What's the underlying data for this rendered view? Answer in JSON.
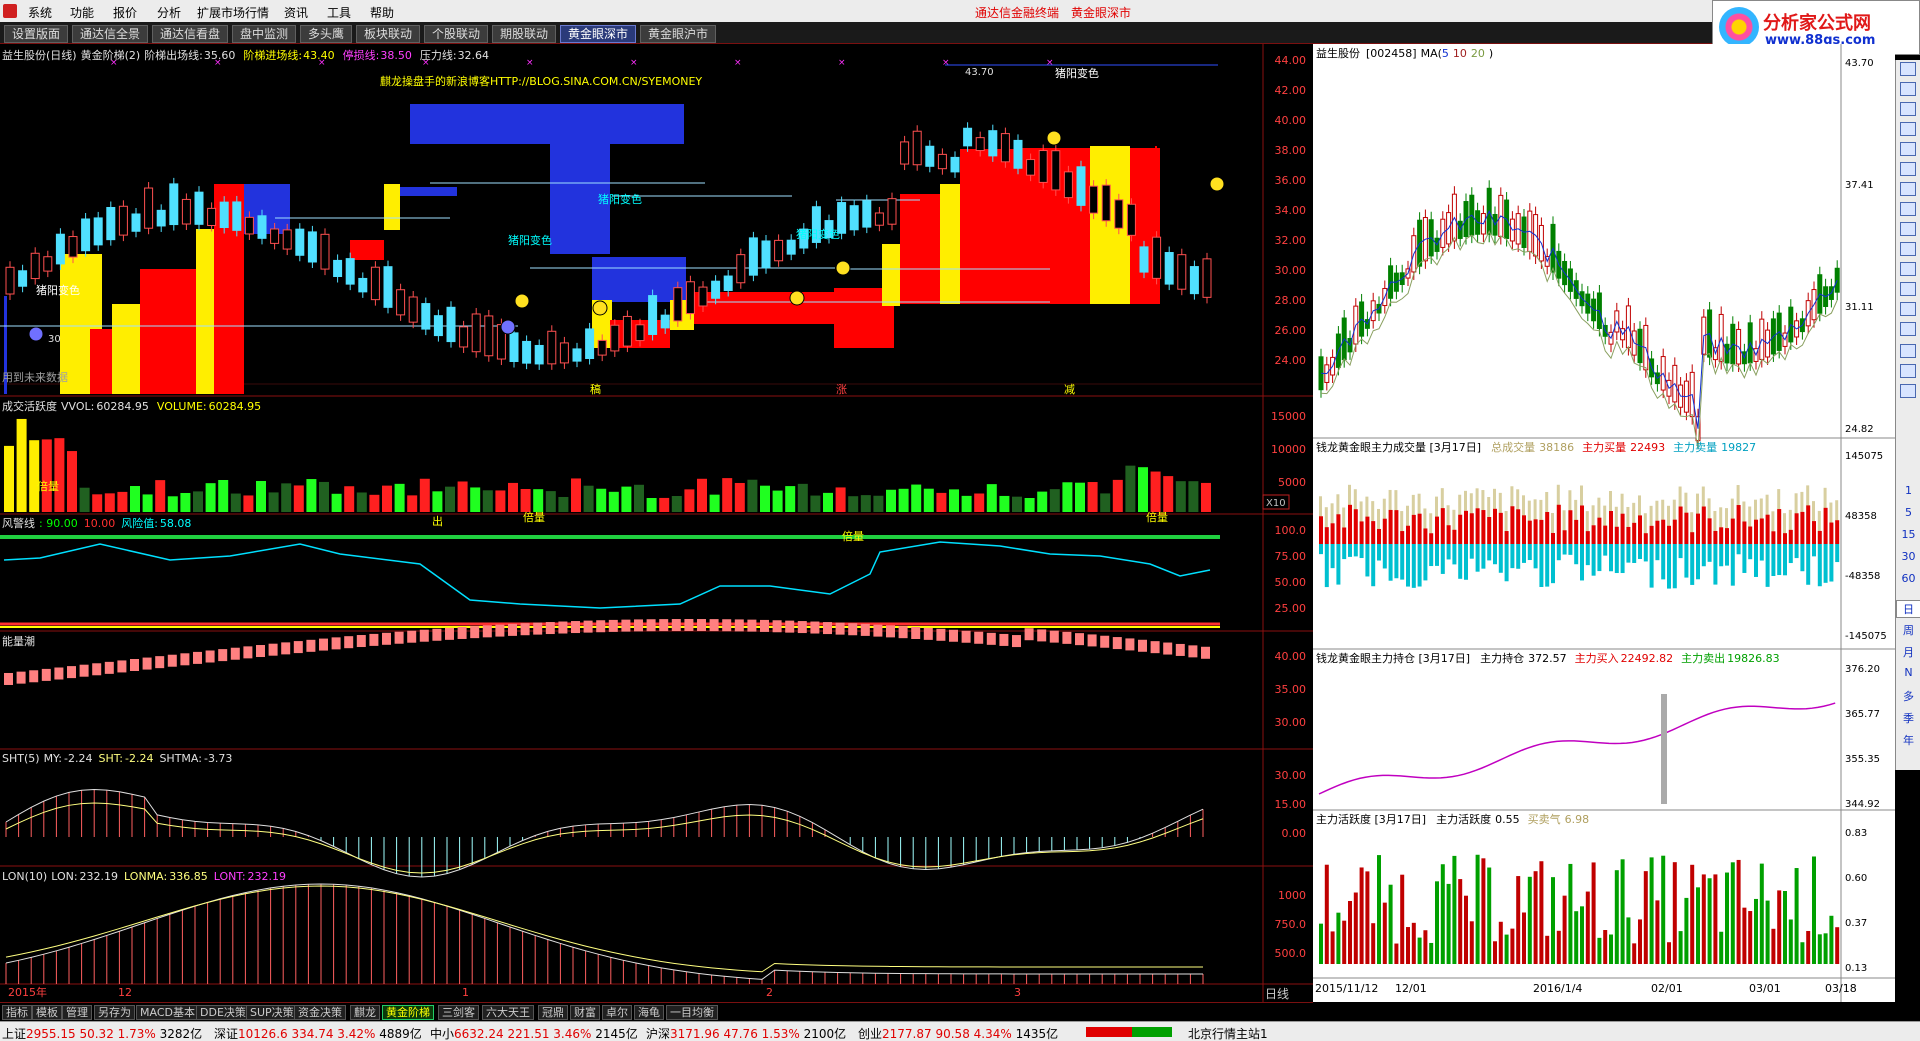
{
  "menu": {
    "items": [
      "系统",
      "功能",
      "报价",
      "分析",
      "扩展市场行情",
      "资讯",
      "工具",
      "帮助"
    ],
    "banner": [
      "通达信金融终端",
      "黄金眼深市"
    ]
  },
  "tabs": [
    "设置版面",
    "通达信全景",
    "通达信看盘",
    "盘中监测",
    "多头鹰",
    "板块联动",
    "个股联动",
    "期股联动",
    "黄金眼深市",
    "黄金眼沪市"
  ],
  "active_tab": "黄金眼深市",
  "site_logo": {
    "title": "分析家公式网",
    "url": "www.88gs.com"
  },
  "main": {
    "header": {
      "name": "益生股份(日线)",
      "indicator": "黄金阶梯(2)",
      "exit_label": "阶梯出场线:",
      "exit_value": "35.60",
      "entry_label": "阶梯进场线:",
      "entry_value": "43.40",
      "stoploss_label": "停损线:",
      "stoploss_value": "38.50",
      "pressure_label": "压力线:",
      "pressure_value": "32.64"
    },
    "blog": "麒龙操盘手的新浪博客HTTP://BLOG.SINA.COM.CN/SYEMONEY",
    "future_note": "用到未来数据",
    "marks": [
      "猪阳变色",
      "猪阳变色",
      "猪阳变色",
      "猪阳变色",
      "猪阳变色"
    ],
    "high_label": "43.70",
    "low_label": "30",
    "zone_labels": [
      "稿",
      "涨",
      "减"
    ],
    "price_axis": [
      "44.00",
      "42.00",
      "40.00",
      "38.00",
      "36.00",
      "34.00",
      "32.00",
      "30.00",
      "28.00",
      "26.00",
      "24.00"
    ],
    "volume_panel": {
      "title": "成交活跃度",
      "vvol_label": "VVOL:",
      "vvol": "60284.95",
      "volume_label": "VOLUME:",
      "volume": "60284.95",
      "axis": [
        "15000",
        "10000",
        "5000"
      ],
      "unit": "X10",
      "tags": [
        "倍量",
        "倍量",
        "倍量",
        "倍量",
        "出"
      ]
    },
    "risk_panel": {
      "title": "风警线",
      "a": ": 90.00",
      "b": "10.00",
      "risk_label": "风险值:",
      "risk": "58.08",
      "axis": [
        "100.0",
        "75.00",
        "50.00",
        "25.00"
      ]
    },
    "energy_panel": {
      "title": "能量潮",
      "axis": [
        "40.00",
        "35.00",
        "30.00"
      ]
    },
    "sht_panel": {
      "title": "SHT(5)",
      "my_label": "MY:",
      "my": "-2.24",
      "sht_label": "SHT:",
      "sht": "-2.24",
      "shtma_label": "SHTMA:",
      "shtma": "-3.73",
      "axis": [
        "30.00",
        "15.00",
        "0.00"
      ]
    },
    "lon_panel": {
      "title": "LON(10)",
      "lon_label": "LON:",
      "lon": "232.19",
      "lonma_label": "LONMA:",
      "lonma": "336.85",
      "lont_label": "LONT:",
      "lont": "232.19",
      "axis": [
        "1000",
        "750.0",
        "500.0"
      ]
    },
    "date_axis": [
      "2015年",
      "12",
      "1",
      "2",
      "3"
    ],
    "period": "日线"
  },
  "side": {
    "k": {
      "name": "益生股份",
      "code": "[002458]",
      "ma_label": "MA(",
      "ma": [
        "5",
        "10",
        "20"
      ],
      "ma_close": ")",
      "axis": [
        "43.70",
        "37.41",
        "31.11",
        "24.82"
      ]
    },
    "vol": {
      "title": "钱龙黄金眼主力成交量 [3月17日]",
      "total_label": "总成交量",
      "total": "38186",
      "buy_label": "主力买量",
      "buy": "22493",
      "sell_label": "主力卖量",
      "sell": "19827",
      "axis": [
        "145075",
        "48358",
        "-48358",
        "-145075"
      ]
    },
    "pos": {
      "title": "钱龙黄金眼主力持仓 [3月17日]",
      "hold_label": "主力持仓",
      "hold": "372.57",
      "buy_label": "主力买入",
      "buy": "22492.82",
      "sell_label": "主力卖出",
      "sell": "19826.83",
      "axis": [
        "376.20",
        "365.77",
        "355.35",
        "344.92"
      ]
    },
    "act": {
      "title": "主力活跃度 [3月17日]",
      "act_label": "主力活跃度",
      "act": "0.55",
      "mood_label": "买卖气",
      "mood": "6.98",
      "axis": [
        "0.83",
        "0.60",
        "0.37",
        "0.13"
      ]
    },
    "dates": [
      "2015/11/12",
      "12/01",
      "2016/1/4",
      "02/01",
      "03/01",
      "03/18"
    ]
  },
  "right_toolbar": [
    "1",
    "5",
    "15",
    "30",
    "60",
    "日",
    "周",
    "月",
    "N",
    "多",
    "季",
    "年"
  ],
  "bottom_tabs": [
    "指标",
    "模板",
    "管理",
    "另存为",
    "MACD基本",
    "DDE决策",
    "SUP决策",
    "资金决策",
    "麒龙",
    "黄金阶梯",
    "三剑客",
    "六大天王",
    "冠鼎",
    "财富",
    "卓尔",
    "海龟",
    "一目均衡"
  ],
  "active_bottom_tab": "黄金阶梯",
  "status": [
    {
      "name": "上证",
      "v": "2955.15",
      "c": "50.32",
      "p": "1.73%",
      "a": "3282亿"
    },
    {
      "name": "深证",
      "v": "10126.6",
      "c": "334.74",
      "p": "3.42%",
      "a": "4889亿"
    },
    {
      "name": "中小",
      "v": "6632.24",
      "c": "221.51",
      "p": "3.46%",
      "a": "2145亿"
    },
    {
      "name": "沪深",
      "v": "3171.96",
      "c": "47.76",
      "p": "1.53%",
      "a": "2100亿"
    },
    {
      "name": "创业",
      "v": "2177.87",
      "c": "90.58",
      "p": "4.34%",
      "a": "1435亿"
    }
  ],
  "status_right": "北京行情主站1"
}
